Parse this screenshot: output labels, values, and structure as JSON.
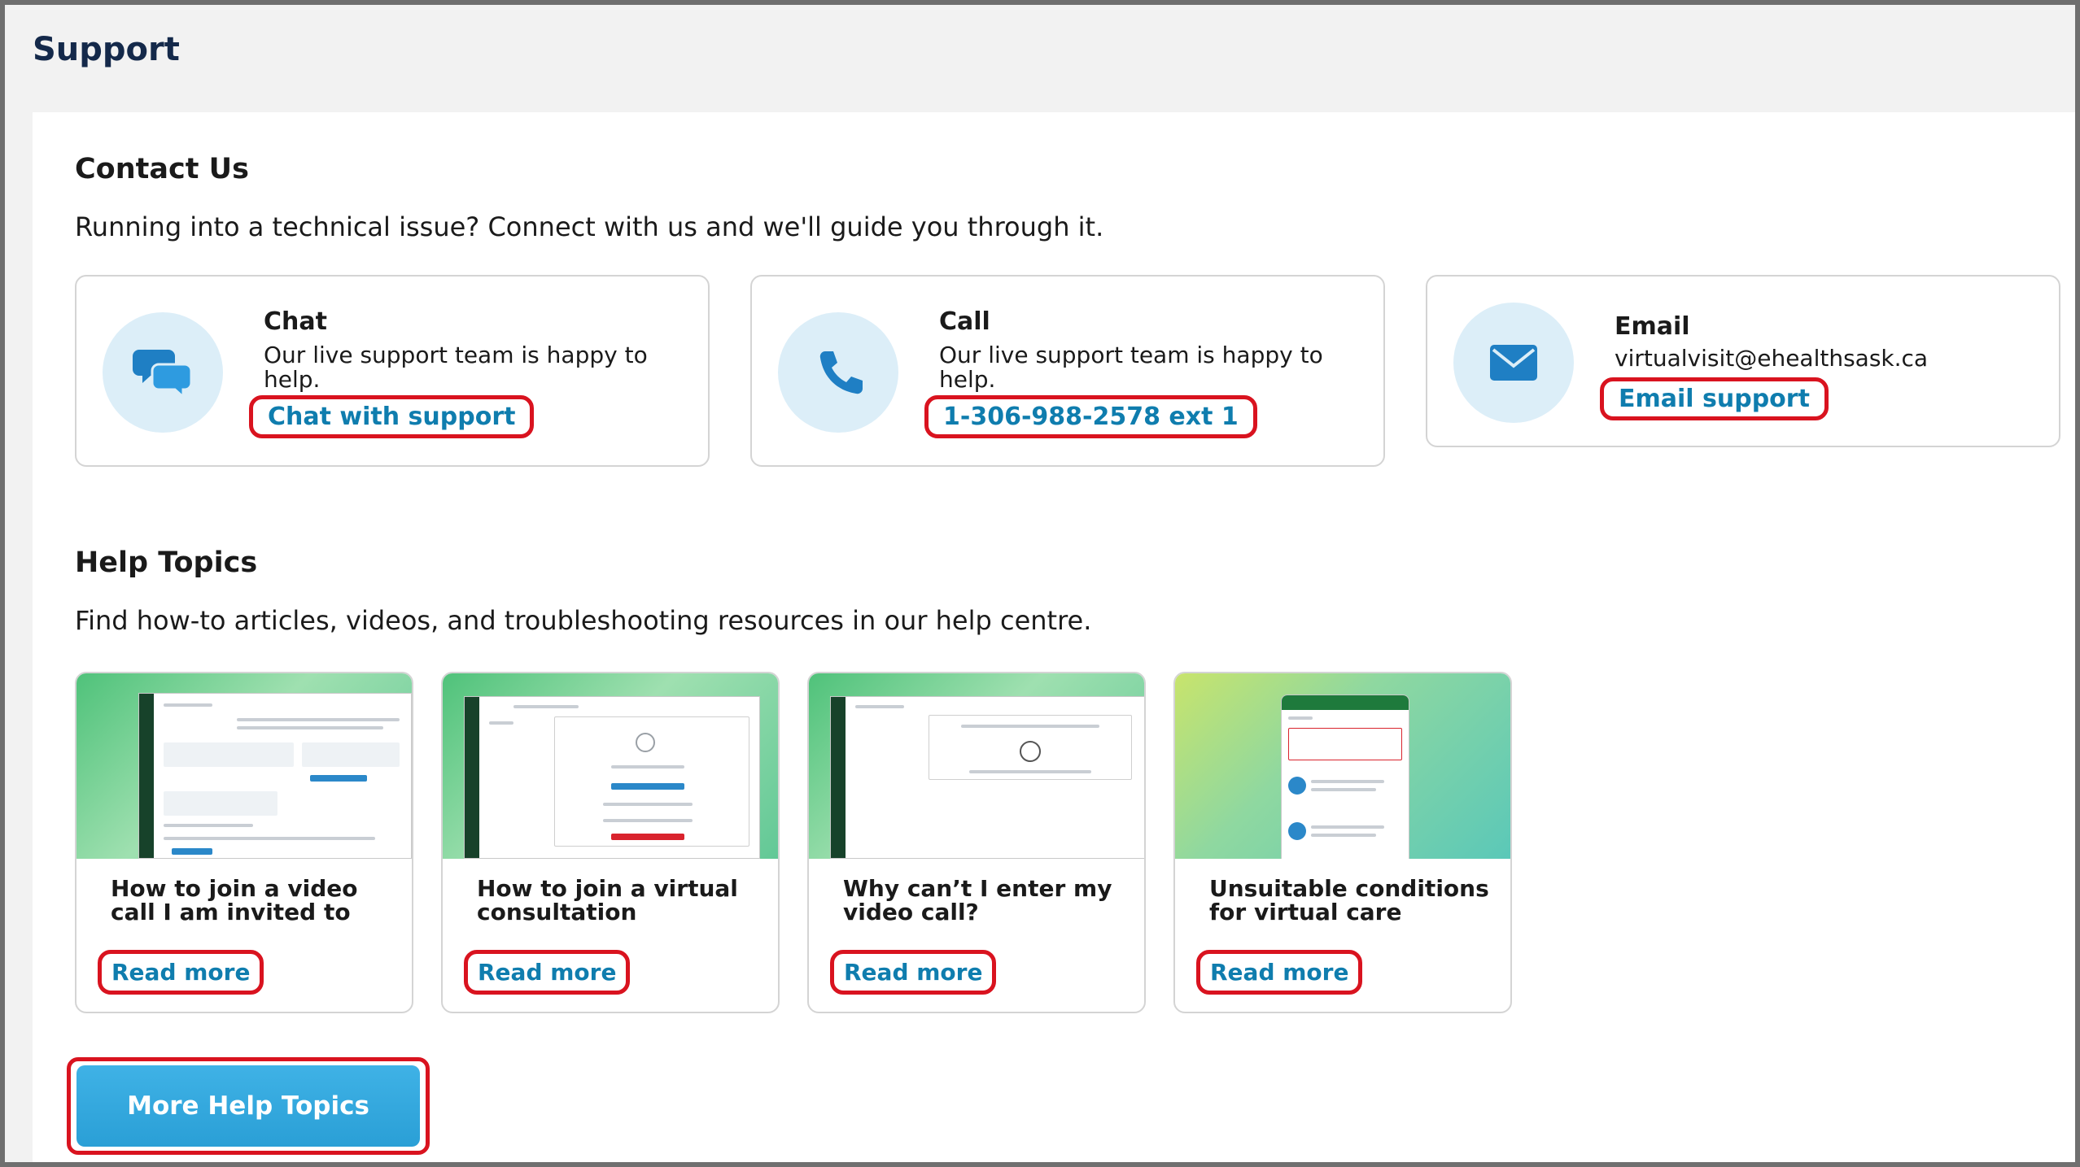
{
  "page": {
    "title": "Support"
  },
  "contact": {
    "title": "Contact Us",
    "description": "Running into a technical issue? Connect with us and we'll guide you through it.",
    "cards": [
      {
        "icon": "chat-bubbles-icon",
        "heading": "Chat",
        "text": "Our live support team is happy to help.",
        "link": "Chat with support"
      },
      {
        "icon": "phone-icon",
        "heading": "Call",
        "text": "Our live support team is happy to help.",
        "link": "1-306-988-2578 ext 1"
      },
      {
        "icon": "envelope-icon",
        "heading": "Email",
        "text": "virtualvisit@ehealthsask.ca",
        "link": "Email support"
      }
    ]
  },
  "help": {
    "title": "Help Topics",
    "description": "Find how-to articles, videos, and troubleshooting resources in our help centre.",
    "topics": [
      {
        "title": "How to join a video call I am invited to",
        "link": "Read more"
      },
      {
        "title": "How to join a virtual consultation",
        "link": "Read more"
      },
      {
        "title": "Why can’t I enter my video call?",
        "link": "Read more"
      },
      {
        "title": "Unsuitable conditions for virtual care",
        "link": "Read more"
      }
    ],
    "more_button": "More Help Topics"
  },
  "colors": {
    "link": "#0f7dae",
    "highlight": "#d9131f",
    "primary_button": "#2a9fd6",
    "icon_circle": "#dceef8",
    "title": "#14294a"
  }
}
